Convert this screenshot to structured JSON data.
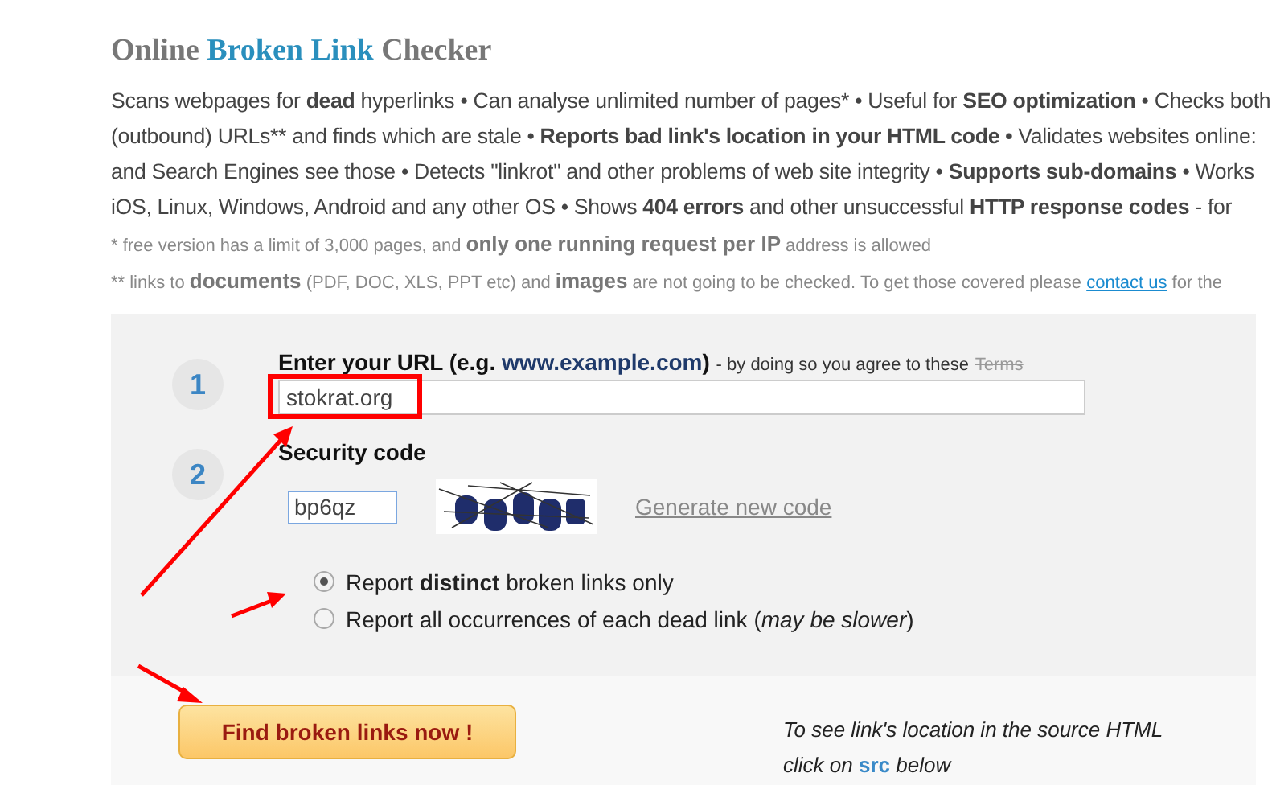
{
  "title": {
    "before": "Online",
    "highlight": "Broken Link",
    "after": "Checker"
  },
  "description_lines": [
    "Scans webpages for **dead** hyperlinks • Can analyse unlimited number of pages* • Useful for **SEO optimization** • Checks both",
    "(outbound) URLs** and finds which are stale • **Reports bad link's location in your HTML code •** Validates websites online:",
    "and Search Engines see those • Detects \"linkrot\" and other problems of web site integrity • **Supports sub-domains** • Works",
    "iOS, Linux, Windows, Android and any other OS • Shows **404 errors** and other unsuccessful **HTTP response codes** - for"
  ],
  "footnotes": [
    {
      "text": "*  free version has a limit of 3,000 pages, and **only one running request per IP** address is allowed"
    },
    {
      "text": "** links to **documents** (PDF, DOC, XLS, PPT etc) and **images** are not going to be checked. To get those covered please",
      "link": "contact us",
      "after": "for the"
    }
  ],
  "step1": {
    "number": "1",
    "label": "Enter your URL (e.g. **www.example.com**)",
    "note": "- by doing so you agree to these",
    "terms": "Terms",
    "value": "stokrat.org"
  },
  "step2": {
    "number": "2",
    "label": "Security code",
    "value": "bp6qz",
    "generate": "Generate new code"
  },
  "options": [
    {
      "label": "Report **distinct** broken links only",
      "selected": true
    },
    {
      "label": "Report all occurrences of each dead link (*may be slower*)",
      "selected": false
    }
  ],
  "submit": "Find broken links now !",
  "hint": {
    "line1": "To see link's location in the source HTML",
    "before": "click on",
    "link": "src",
    "after": "below"
  }
}
